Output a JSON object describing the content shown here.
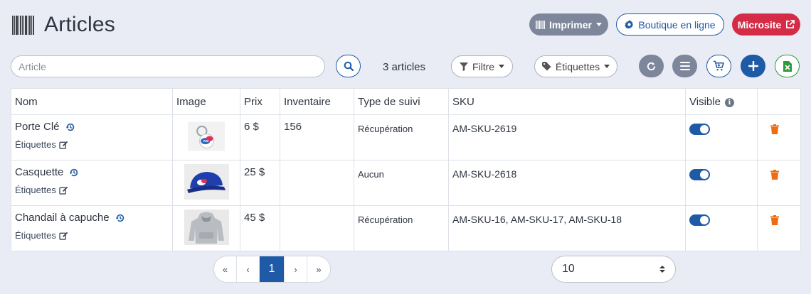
{
  "header": {
    "title": "Articles",
    "print_label": "Imprimer",
    "shop_label": "Boutique en ligne",
    "microsite_label": "Microsite"
  },
  "toolbar": {
    "search_placeholder": "Article",
    "count_text": "3 articles",
    "filter_label": "Filtre",
    "labels_label": "Étiquettes"
  },
  "table": {
    "columns": [
      "Nom",
      "Image",
      "Prix",
      "Inventaire",
      "Type de suivi",
      "SKU",
      "Visible",
      ""
    ],
    "rows": [
      {
        "name": "Porte Clé",
        "tags_label": "Étiquettes",
        "image_icon": "keychain-image",
        "price": "6 $",
        "inventory": "156",
        "tracking": "Récupération",
        "sku": "AM-SKU-2619",
        "visible": true
      },
      {
        "name": "Casquette",
        "tags_label": "Étiquettes",
        "image_icon": "cap-image",
        "price": "25 $",
        "inventory": "",
        "tracking": "Aucun",
        "sku": "AM-SKU-2618",
        "visible": true
      },
      {
        "name": "Chandail à capuche",
        "tags_label": "Étiquettes",
        "image_icon": "hoodie-image",
        "price": "45 $",
        "inventory": "",
        "tracking": "Récupération",
        "sku": "AM-SKU-16, AM-SKU-17, AM-SKU-18",
        "visible": true
      }
    ]
  },
  "pagination": {
    "first": "«",
    "prev": "‹",
    "current": "1",
    "next": "›",
    "last": "»"
  },
  "page_size": {
    "selected": "10"
  },
  "colors": {
    "primary": "#1e5aa6",
    "danger": "#d42b47",
    "grey_button": "#7d869a",
    "success": "#2e9a3a",
    "trash": "#ee6d12",
    "background": "#e9ecf5"
  }
}
